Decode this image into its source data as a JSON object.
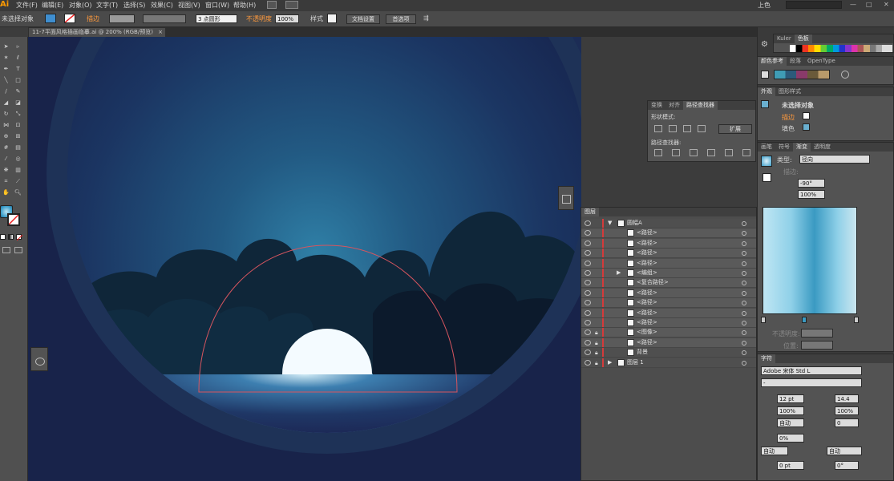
{
  "app": {
    "logo": "Ai"
  },
  "menu": [
    "文件(F)",
    "编辑(E)",
    "对象(O)",
    "文字(T)",
    "选择(S)",
    "效果(C)",
    "视图(V)",
    "窗口(W)",
    "帮助(H)"
  ],
  "workspace": "上色",
  "control": {
    "no_selection": "未选择对象",
    "stroke_label": "描边",
    "stroke_style": "3 点圆形",
    "opacity_label": "不透明度",
    "opacity_value": "100%",
    "style_label": "样式",
    "doc_setup": "文档设置",
    "preferences": "首选项"
  },
  "document_tab": {
    "title": "11-7平面风格插画临摹.ai @ 200% (RGB/预览)",
    "close": "×"
  },
  "pathfinder": {
    "tabs": [
      "变换",
      "对齐",
      "路径查找器"
    ],
    "shape_modes": "形状模式:",
    "pathfinders": "路径查找器:",
    "expand": "扩展"
  },
  "layers": {
    "title": "图层",
    "rows": [
      {
        "name": "圆幅A",
        "indent": 0,
        "expand": "▼"
      },
      {
        "name": "<路径>",
        "indent": 1
      },
      {
        "name": "<路径>",
        "indent": 1
      },
      {
        "name": "<路径>",
        "indent": 1
      },
      {
        "name": "<路径>",
        "indent": 1
      },
      {
        "name": "<编组>",
        "indent": 1,
        "expand": "▶"
      },
      {
        "name": "<复合路径>",
        "indent": 1
      },
      {
        "name": "<路径>",
        "indent": 1
      },
      {
        "name": "<路径>",
        "indent": 1
      },
      {
        "name": "<路径>",
        "indent": 1
      },
      {
        "name": "<路径>",
        "indent": 1
      },
      {
        "name": "<图像>",
        "indent": 1,
        "lock": true
      },
      {
        "name": "<路径>",
        "indent": 1,
        "lock": true
      },
      {
        "name": "背景",
        "indent": 1,
        "lock": true
      },
      {
        "name": "图层 1",
        "indent": 0,
        "lock": true,
        "expand": "▶"
      }
    ]
  },
  "right": {
    "kuler_tabs": [
      "Kuler",
      "色板"
    ],
    "color_guide_tabs": [
      "颜色参考",
      "段落",
      "OpenType"
    ],
    "appearance_tabs": [
      "外观",
      "图形样式"
    ],
    "appearance_title": "未选择对象",
    "appearance_stroke": "描边",
    "appearance_fill": "填色",
    "gradient_tabs": [
      "画笔",
      "符号",
      "渐变",
      "透明度"
    ],
    "gradient_type_label": "类型:",
    "gradient_type": "径向",
    "gradient_stroke": "描边:",
    "gradient_angle": "-90°",
    "gradient_ratio": "100%",
    "gradient_opacity": "不透明度:",
    "gradient_location": "位置:",
    "character_title": "字符",
    "font_name": "Adobe 宋体 Std L",
    "font_style": "-",
    "font_size": "12 pt",
    "leading": "14.4",
    "scale_v": "100%",
    "scale_h": "100%",
    "kerning": "自动",
    "tracking": "0",
    "baseline_pct": "0%",
    "auto1": "自动",
    "auto2": "自动",
    "baseline_pt": "0 pt",
    "rotation": "0°"
  }
}
